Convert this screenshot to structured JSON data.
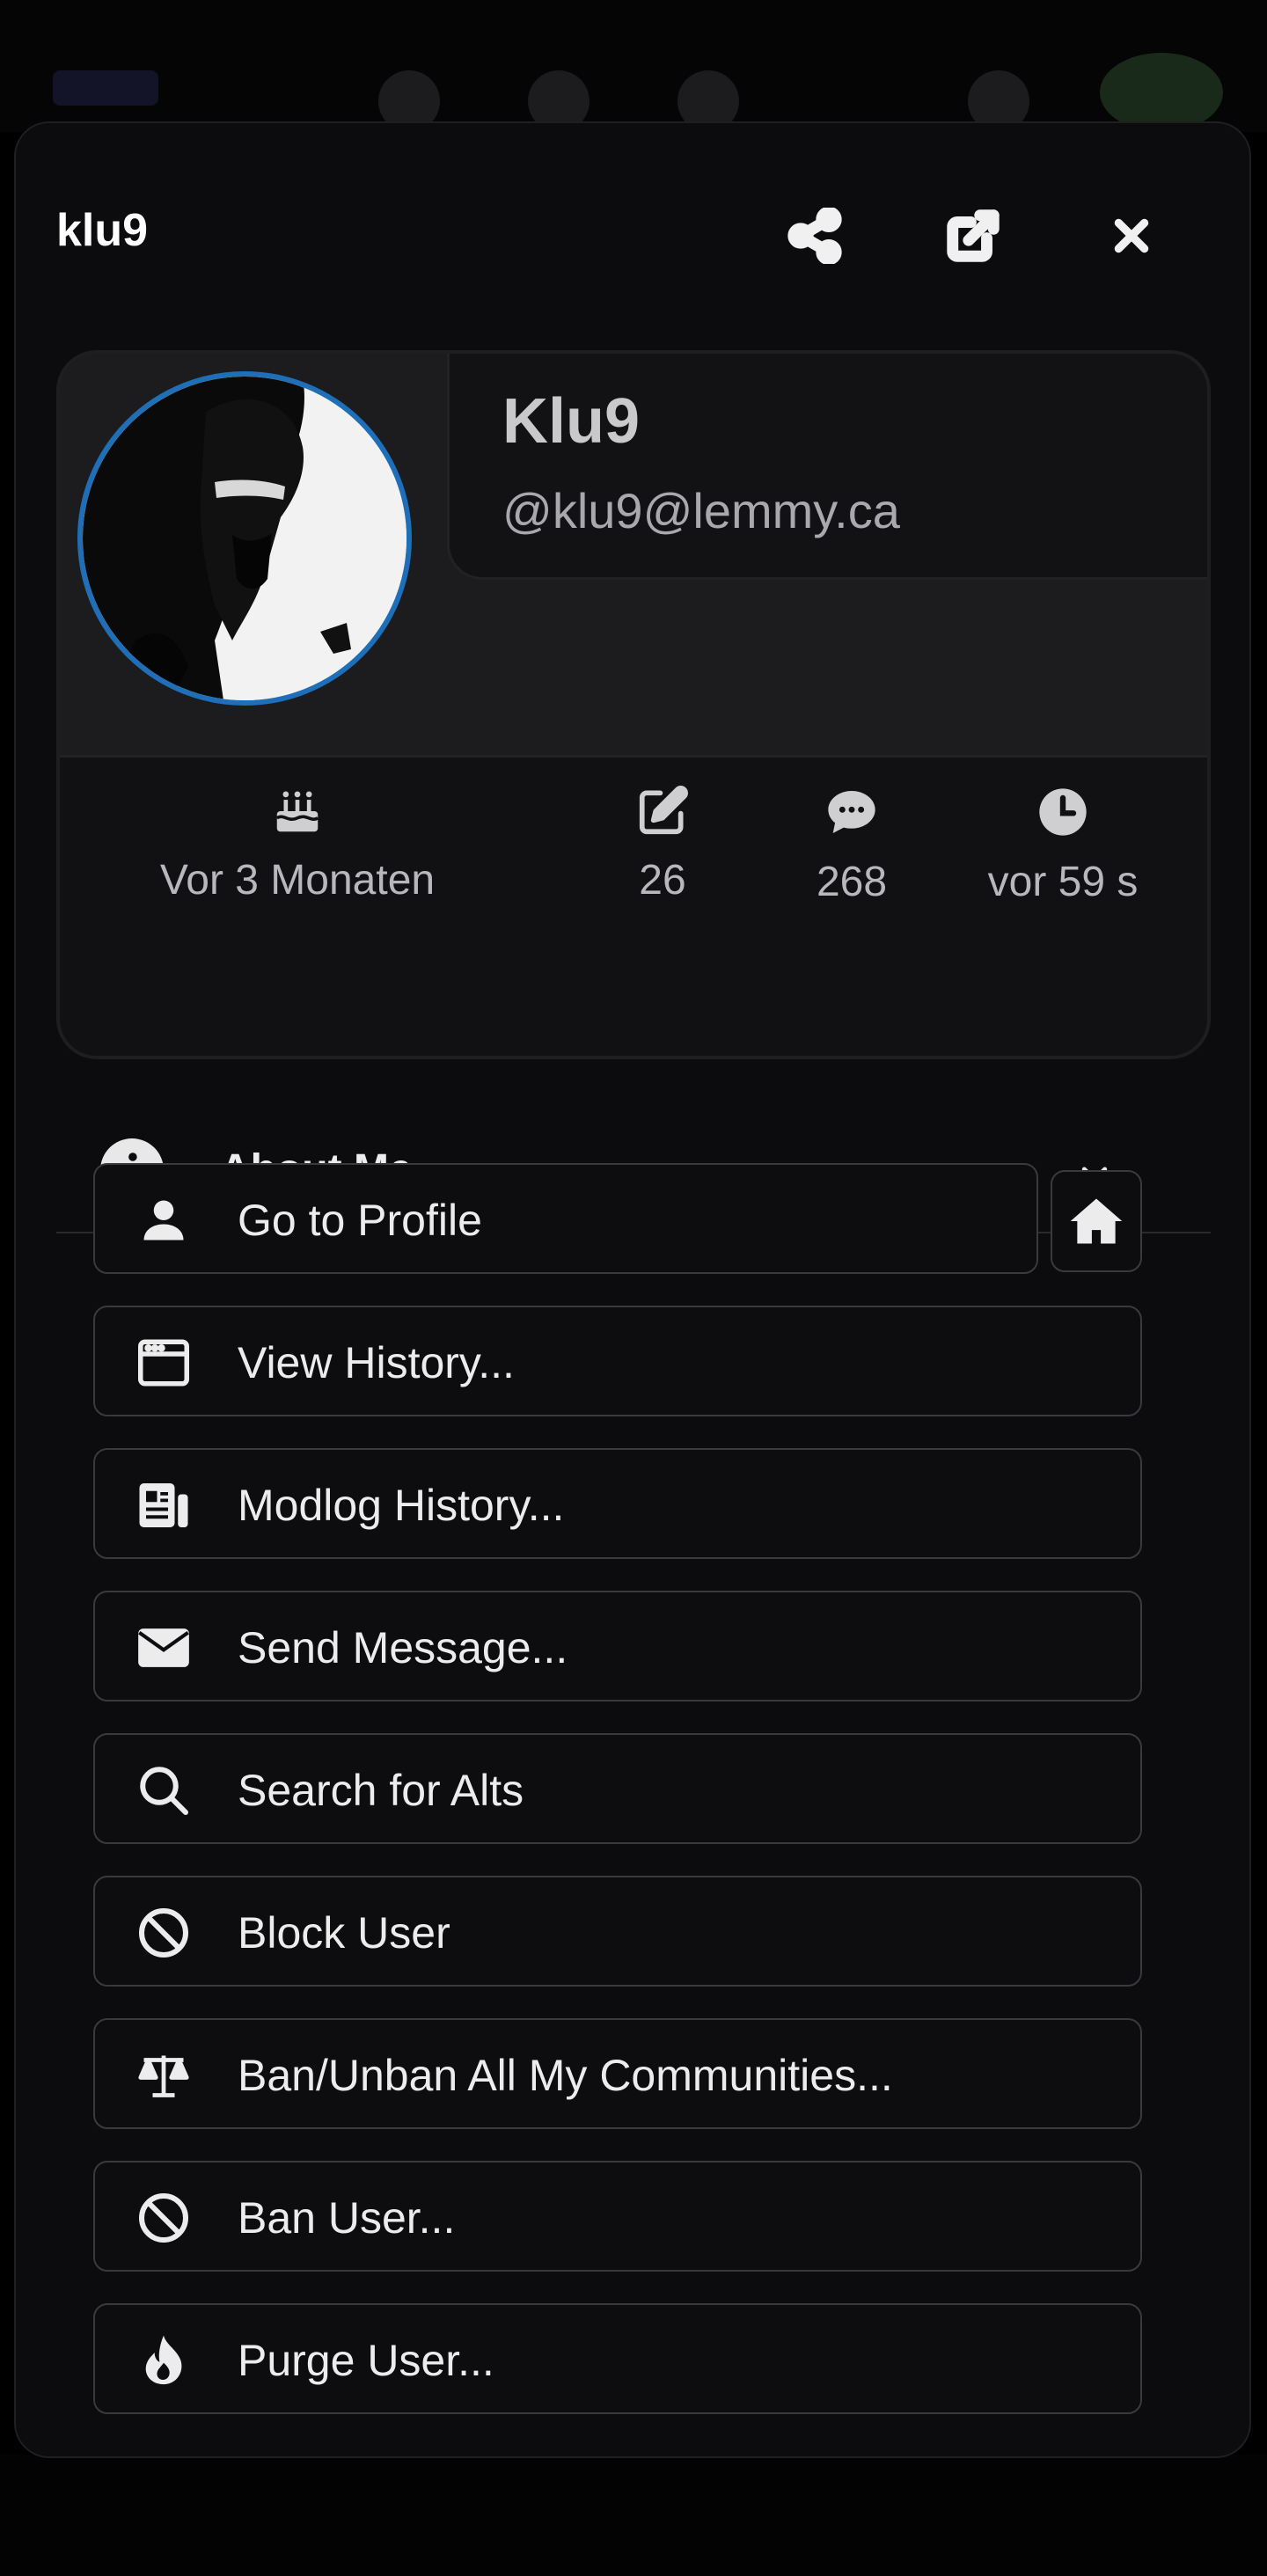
{
  "modal": {
    "title": "klu9",
    "share_icon": "share-icon",
    "open_external_icon": "external-link-icon",
    "close_icon": "close-icon"
  },
  "profile": {
    "display_name": "Klu9",
    "handle": "@klu9@lemmy.ca",
    "stats": [
      {
        "icon": "cake-icon",
        "value": "Vor 3 Monaten"
      },
      {
        "icon": "edit-icon",
        "value": "26"
      },
      {
        "icon": "comment-icon",
        "value": "268"
      },
      {
        "icon": "clock-icon",
        "value": "vor 59 s"
      }
    ]
  },
  "about": {
    "label": "About Me",
    "expanded": false
  },
  "actions": [
    {
      "icon": "user-icon",
      "label": "Go to Profile"
    },
    {
      "icon": "browser-window-icon",
      "label": "View History..."
    },
    {
      "icon": "newspaper-icon",
      "label": "Modlog History..."
    },
    {
      "icon": "envelope-icon",
      "label": "Send Message..."
    },
    {
      "icon": "search-icon",
      "label": "Search for Alts"
    },
    {
      "icon": "ban-icon",
      "label": "Block User"
    },
    {
      "icon": "scale-icon",
      "label": "Ban/Unban All My Communities..."
    },
    {
      "icon": "ban-icon",
      "label": "Ban User..."
    },
    {
      "icon": "fire-icon",
      "label": "Purge User..."
    }
  ],
  "colors": {
    "accent_ring": "#1e6fb8",
    "modal_bg": "#0c0c0e",
    "card_bg": "#18181b"
  }
}
